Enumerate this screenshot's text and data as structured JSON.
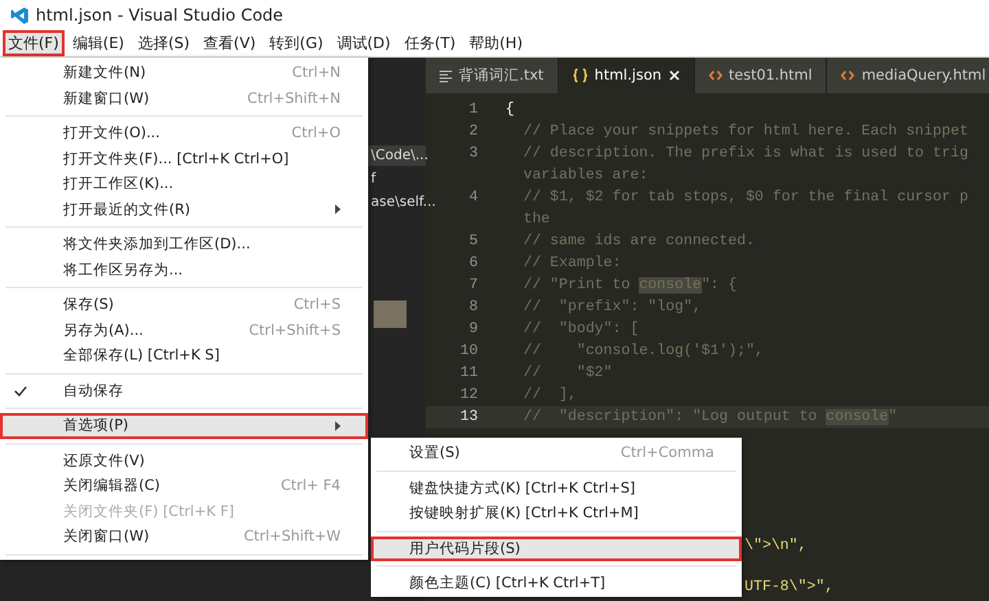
{
  "window": {
    "title": "html.json - Visual Studio Code"
  },
  "menubar": [
    {
      "label": "文件(F)",
      "selected": true,
      "highlighted": true
    },
    {
      "label": "编辑(E)",
      "selected": false,
      "highlighted": false
    },
    {
      "label": "选择(S)",
      "selected": false,
      "highlighted": false
    },
    {
      "label": "查看(V)",
      "selected": false,
      "highlighted": false
    },
    {
      "label": "转到(G)",
      "selected": false,
      "highlighted": false
    },
    {
      "label": "调试(D)",
      "selected": false,
      "highlighted": false
    },
    {
      "label": "任务(T)",
      "selected": false,
      "highlighted": false
    },
    {
      "label": "帮助(H)",
      "selected": false,
      "highlighted": false
    }
  ],
  "file_menu": [
    {
      "kind": "item",
      "label": "新建文件(N)",
      "shortcut": "Ctrl+N",
      "checked": false,
      "disabled": false,
      "submenu": false,
      "selected": false,
      "highlighted": false
    },
    {
      "kind": "item",
      "label": "新建窗口(W)",
      "shortcut": "Ctrl+Shift+N",
      "checked": false,
      "disabled": false,
      "submenu": false,
      "selected": false,
      "highlighted": false
    },
    {
      "kind": "separator"
    },
    {
      "kind": "item",
      "label": "打开文件(O)...",
      "shortcut": "Ctrl+O",
      "checked": false,
      "disabled": false,
      "submenu": false,
      "selected": false,
      "highlighted": false
    },
    {
      "kind": "item",
      "label": "打开文件夹(F)... [Ctrl+K Ctrl+O]",
      "checked": false,
      "disabled": false,
      "submenu": false,
      "selected": false,
      "highlighted": false
    },
    {
      "kind": "item",
      "label": "打开工作区(K)...",
      "checked": false,
      "disabled": false,
      "submenu": false,
      "selected": false,
      "highlighted": false
    },
    {
      "kind": "item",
      "label": "打开最近的文件(R)",
      "checked": false,
      "disabled": false,
      "submenu": true,
      "selected": false,
      "highlighted": false
    },
    {
      "kind": "separator"
    },
    {
      "kind": "item",
      "label": "将文件夹添加到工作区(D)...",
      "checked": false,
      "disabled": false,
      "submenu": false,
      "selected": false,
      "highlighted": false
    },
    {
      "kind": "item",
      "label": "将工作区另存为...",
      "checked": false,
      "disabled": false,
      "submenu": false,
      "selected": false,
      "highlighted": false
    },
    {
      "kind": "separator"
    },
    {
      "kind": "item",
      "label": "保存(S)",
      "shortcut": "Ctrl+S",
      "checked": false,
      "disabled": false,
      "submenu": false,
      "selected": false,
      "highlighted": false
    },
    {
      "kind": "item",
      "label": "另存为(A)...",
      "shortcut": "Ctrl+Shift+S",
      "checked": false,
      "disabled": false,
      "submenu": false,
      "selected": false,
      "highlighted": false
    },
    {
      "kind": "item",
      "label": "全部保存(L) [Ctrl+K S]",
      "checked": false,
      "disabled": false,
      "submenu": false,
      "selected": false,
      "highlighted": false
    },
    {
      "kind": "separator"
    },
    {
      "kind": "item",
      "label": "自动保存",
      "checked": true,
      "disabled": false,
      "submenu": false,
      "selected": false,
      "highlighted": false
    },
    {
      "kind": "separator"
    },
    {
      "kind": "item",
      "label": "首选项(P)",
      "checked": false,
      "disabled": false,
      "submenu": true,
      "selected": true,
      "highlighted": true
    },
    {
      "kind": "separator"
    },
    {
      "kind": "item",
      "label": "还原文件(V)",
      "checked": false,
      "disabled": false,
      "submenu": false,
      "selected": false,
      "highlighted": false
    },
    {
      "kind": "item",
      "label": "关闭编辑器(C)",
      "shortcut": "Ctrl+ F4",
      "checked": false,
      "disabled": false,
      "submenu": false,
      "selected": false,
      "highlighted": false
    },
    {
      "kind": "item",
      "label": "关闭文件夹(F) [Ctrl+K F]",
      "checked": false,
      "disabled": true,
      "submenu": false,
      "selected": false,
      "highlighted": false
    },
    {
      "kind": "item",
      "label": "关闭窗口(W)",
      "shortcut": "Ctrl+Shift+W",
      "checked": false,
      "disabled": false,
      "submenu": false,
      "selected": false,
      "highlighted": false
    },
    {
      "kind": "separator"
    }
  ],
  "preferences_submenu": [
    {
      "kind": "item",
      "label": "设置(S)",
      "shortcut": "Ctrl+Comma",
      "selected": false,
      "highlighted": false
    },
    {
      "kind": "separator"
    },
    {
      "kind": "item",
      "label": "键盘快捷方式(K) [Ctrl+K Ctrl+S]",
      "selected": false,
      "highlighted": false
    },
    {
      "kind": "item",
      "label": "按键映射扩展(K) [Ctrl+K Ctrl+M]",
      "selected": false,
      "highlighted": false
    },
    {
      "kind": "separator"
    },
    {
      "kind": "item",
      "label": "用户代码片段(S)",
      "selected": true,
      "highlighted": true
    },
    {
      "kind": "separator"
    },
    {
      "kind": "item",
      "label": "颜色主题(C) [Ctrl+K Ctrl+T]",
      "selected": false,
      "highlighted": false
    }
  ],
  "sidebar": {
    "items": [
      {
        "text": "\\Code\\...",
        "selected": true
      },
      {
        "text": "f",
        "selected": false
      },
      {
        "text": "ase\\self...",
        "selected": false
      }
    ]
  },
  "tabs": [
    {
      "label": "背诵词汇.txt",
      "kind": "text",
      "selected": false
    },
    {
      "label": "html.json",
      "kind": "json",
      "selected": true
    },
    {
      "label": "test01.html",
      "kind": "html",
      "selected": false
    },
    {
      "label": "mediaQuery.html",
      "kind": "html",
      "selected": false
    }
  ],
  "editor": {
    "lines": [
      {
        "number": "1",
        "current": false,
        "parts": [
          {
            "text": "{",
            "highlight": false
          }
        ]
      },
      {
        "number": "2",
        "current": false,
        "parts": [
          {
            "text": "  // Place your snippets for html here. Each snippet",
            "highlight": false
          }
        ]
      },
      {
        "number": "3",
        "current": false,
        "parts": [
          {
            "text": "  // description. The prefix is what is used to trig",
            "highlight": false
          }
        ]
      },
      {
        "current": false,
        "parts": [
          {
            "text": "  variables are:",
            "highlight": false
          }
        ]
      },
      {
        "number": "4",
        "current": false,
        "parts": [
          {
            "text": "  // $1, $2 for tab stops, $0 for the final cursor p",
            "highlight": false
          }
        ]
      },
      {
        "current": false,
        "parts": [
          {
            "text": "  the",
            "highlight": false
          }
        ]
      },
      {
        "number": "5",
        "current": false,
        "parts": [
          {
            "text": "  // same ids are connected.",
            "highlight": false
          }
        ]
      },
      {
        "number": "6",
        "current": false,
        "parts": [
          {
            "text": "  // Example:",
            "highlight": false
          }
        ]
      },
      {
        "number": "7",
        "current": false,
        "parts": [
          {
            "text": "  // \"Print to ",
            "highlight": false
          },
          {
            "text": "console",
            "highlight": true
          },
          {
            "text": "\": {",
            "highlight": false
          }
        ]
      },
      {
        "number": "8",
        "current": false,
        "parts": [
          {
            "text": "  //  \"prefix\": \"log\",",
            "highlight": false
          }
        ]
      },
      {
        "number": "9",
        "current": false,
        "parts": [
          {
            "text": "  //  \"body\": [",
            "highlight": false
          }
        ]
      },
      {
        "number": "10",
        "current": false,
        "parts": [
          {
            "text": "  //    \"console.log('$1');\",",
            "highlight": false
          }
        ]
      },
      {
        "number": "11",
        "current": false,
        "parts": [
          {
            "text": "  //    \"$2\"",
            "highlight": false
          }
        ]
      },
      {
        "number": "12",
        "current": false,
        "parts": [
          {
            "text": "  //  ],",
            "highlight": false
          }
        ]
      },
      {
        "number": "13",
        "current": true,
        "parts": [
          {
            "text": "  //  \"description\": \"Log output to ",
            "highlight": false
          },
          {
            "text": "console",
            "highlight": true
          },
          {
            "text": "\"",
            "highlight": false
          }
        ]
      }
    ],
    "fragments": [
      {
        "text": "\\\">\\n\","
      },
      {
        "text": "UTF-8\\\">\","
      }
    ]
  }
}
